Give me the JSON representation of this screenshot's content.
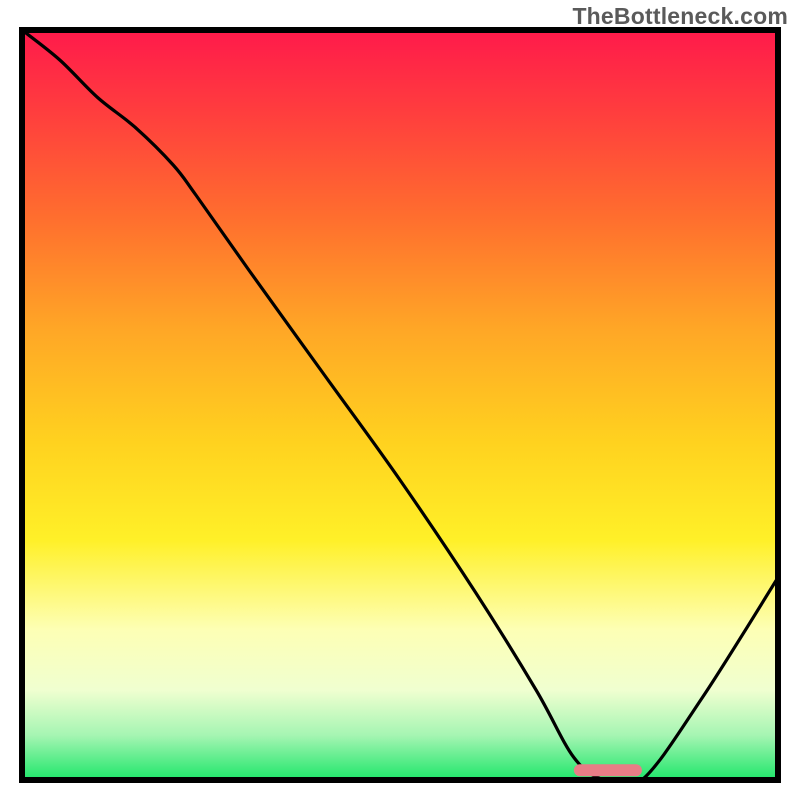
{
  "watermark": "TheBottleneck.com",
  "chart_data": {
    "type": "line",
    "title": "",
    "xlabel": "",
    "ylabel": "",
    "x_range": [
      0,
      100
    ],
    "y_range": [
      0,
      100
    ],
    "description": "Bottleneck curve over a heatmap gradient. Vertical axis: bottleneck percentage (red=100 at top, green=0 at bottom). Horizontal axis: component relative performance scale 0–100. Curve has a sharp minimum near x≈77 (optimal, ~0% bottleneck), rising toward 100% at x≈0 and ~27% at x=100. Pink marker shows recommended operating band.",
    "series": [
      {
        "name": "bottleneck-curve",
        "x": [
          0,
          5,
          10,
          15,
          20,
          23,
          30,
          40,
          50,
          60,
          68,
          73,
          77,
          82,
          90,
          100
        ],
        "y": [
          100,
          96,
          91,
          87,
          82,
          78,
          68,
          54,
          40,
          25,
          12,
          3,
          0,
          0,
          11,
          27
        ]
      }
    ],
    "marker": {
      "x_start": 73,
      "x_end": 82,
      "y": 1.3,
      "color": "#e87d86"
    },
    "gradient_stops": [
      {
        "offset": 0.0,
        "color": "#ff1a4b"
      },
      {
        "offset": 0.1,
        "color": "#ff3a3f"
      },
      {
        "offset": 0.25,
        "color": "#ff6e2e"
      },
      {
        "offset": 0.4,
        "color": "#ffa726"
      },
      {
        "offset": 0.55,
        "color": "#ffd21f"
      },
      {
        "offset": 0.68,
        "color": "#fff028"
      },
      {
        "offset": 0.8,
        "color": "#fdffb5"
      },
      {
        "offset": 0.88,
        "color": "#f0ffd0"
      },
      {
        "offset": 0.94,
        "color": "#a6f5b3"
      },
      {
        "offset": 1.0,
        "color": "#1ee66a"
      }
    ],
    "frame": {
      "stroke": "#000000",
      "stroke_width": 6
    }
  }
}
